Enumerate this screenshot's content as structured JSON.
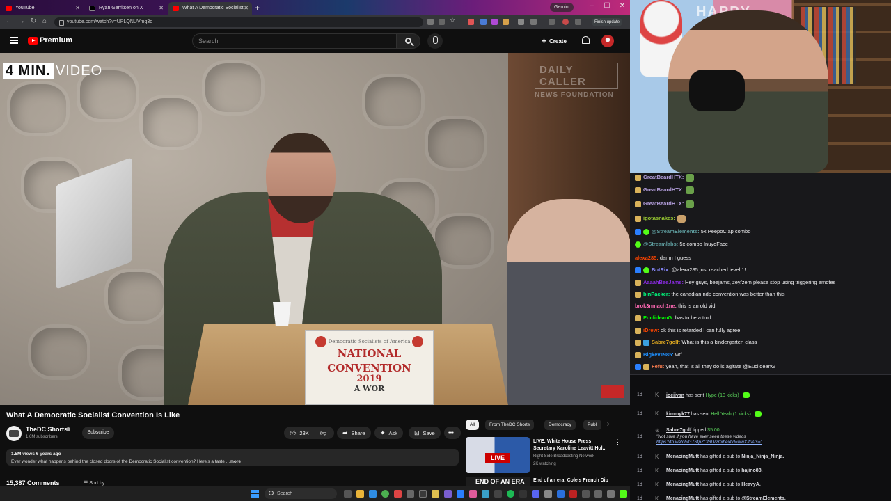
{
  "browser": {
    "tabs": [
      {
        "title": "YouTube",
        "active": false
      },
      {
        "title": "Ryan Gerritsen on X",
        "active": false
      },
      {
        "title": "What A Democratic Socialist",
        "active": true
      }
    ],
    "gemini_label": "Gemini",
    "url": "youtube.com/watch?v=UPLQNUVmq3o",
    "finish_update": "Finish update"
  },
  "youtube": {
    "logo_text": "Premium",
    "search_placeholder": "Search",
    "create_label": "Create",
    "video": {
      "badge_number": "4 MIN.",
      "badge_word": "VIDEO",
      "watermark_line1": "DAILY CALLER",
      "watermark_line2": "NEWS FOUNDATION",
      "sign_line1": "Democratic Socialists of America",
      "sign_line2": "NATIONAL",
      "sign_line3": "CONVENTION",
      "sign_year": "2019",
      "sign_footer": "A WOR"
    },
    "title": "What A Democratic Socialist Convention Is Like",
    "channel": {
      "name": "TheDC Shorts",
      "subscribers": "1.6M subscribers",
      "subscribe_label": "Subscribe"
    },
    "actions": {
      "likes": "23K",
      "share": "Share",
      "ask": "Ask",
      "save": "Save"
    },
    "description": {
      "meta": "1.5M views  6 years ago",
      "text": "Ever wonder what happens behind the closed doors of the Democratic Socialist convention?  Here's a taste ...",
      "more": "more"
    },
    "comments_label": "15,387 Comments",
    "sort_label": "Sort by",
    "chips": [
      "All",
      "From TheDC Shorts",
      "Democracy",
      "Publ"
    ],
    "recommendations": [
      {
        "title": "LIVE: White House Press Secretary Karoline Leavitt Hol...",
        "channel": "Right Side Broadcasting Network",
        "meta": "2K watching",
        "thumb_label": "LIVE"
      },
      {
        "title": "End of an era: Cole's French Dip",
        "thumb_label": "END OF AN ERA"
      }
    ]
  },
  "taskbar": {
    "search_placeholder": "Search"
  },
  "webcam": {
    "sign_text": "HAPPY"
  },
  "chat": [
    {
      "user": "GreatBeardHTX:",
      "message": "",
      "user_color": "#b9a3e3"
    },
    {
      "user": "GreatBeardHTX:",
      "message": "",
      "user_color": "#b9a3e3"
    },
    {
      "user": "GreatBeardHTX:",
      "message": "",
      "user_color": "#b9a3e3"
    },
    {
      "user": "igotasnakes:",
      "message": "",
      "user_color": "#9acd32"
    },
    {
      "user": "@StreamElements:",
      "message": "5x PeepoClap combo",
      "user_color": "#5f9ea0"
    },
    {
      "user": "@Streamlabs:",
      "message": "5x       combo InuyoFace",
      "user_color": "#5f9ea0"
    },
    {
      "user": "alexa285:",
      "message": "damn I guess",
      "user_color": "#ff4500"
    },
    {
      "user": "BotRix:",
      "message": "@alexa285 just reached level 1!",
      "user_color": "#8a8aff"
    },
    {
      "user": "AaaahBeeJams:",
      "message": "Hey guys, beejams, zey/zem please stop using triggering emotes",
      "user_color": "#8a2be2"
    },
    {
      "user": "binPacker:",
      "message": "the canadian ndp convention was better than this",
      "user_color": "#00ff7f"
    },
    {
      "user": "brok3nmach1ne:",
      "message": "this is an old vid",
      "user_color": "#ff69b4"
    },
    {
      "user": "EuclideanG:",
      "message": "has to be a troll",
      "user_color": "#00ff00"
    },
    {
      "user": "iDrew:",
      "message": "ok this is retarded I can fully agree",
      "user_color": "#ff4500"
    },
    {
      "user": "Sabre7golf:",
      "message": "What is this a kindergarten class",
      "user_color": "#daa520"
    },
    {
      "user": "Bigkev1985:",
      "message": "wtf",
      "user_color": "#1e90ff"
    },
    {
      "user": "Fefu:",
      "message": "yeah, that is all they do is agitate @EuclideanG",
      "user_color": "#ff7f50"
    }
  ],
  "activity": [
    {
      "time": "1d",
      "user": "joeiivan",
      "text": "has sent",
      "highlight": "Hype (10 kicks)"
    },
    {
      "time": "1d",
      "user": "kimmyk77",
      "text": "has sent",
      "highlight": "Hell Yeah (1 kicks)"
    },
    {
      "time": "1d",
      "user": "Sabre7golf",
      "text": "tipped",
      "highlight": "$5.00",
      "quote": "\"Not sure if you have ever seen these videos",
      "link": "https://fb.watch/G7StpZOf3D/?mibextid=wwXIfr&rs=\""
    },
    {
      "time": "1d",
      "user": "MenacingMutt",
      "text": "has gifted a sub to",
      "target": "Ninja_Ninja_Ninja."
    },
    {
      "time": "1d",
      "user": "MenacingMutt",
      "text": "has gifted a sub to",
      "target": "hajino88."
    },
    {
      "time": "1d",
      "user": "MenacingMutt",
      "text": "has gifted a sub to",
      "target": "HeavyA."
    },
    {
      "time": "1d",
      "user": "MenacingMutt",
      "text": "has gifted a sub to",
      "target": "@StreamElements."
    }
  ],
  "colors": {
    "youtube_red": "#ff0000",
    "chat_bg": "#18181b",
    "kick_green": "#53fc18"
  }
}
